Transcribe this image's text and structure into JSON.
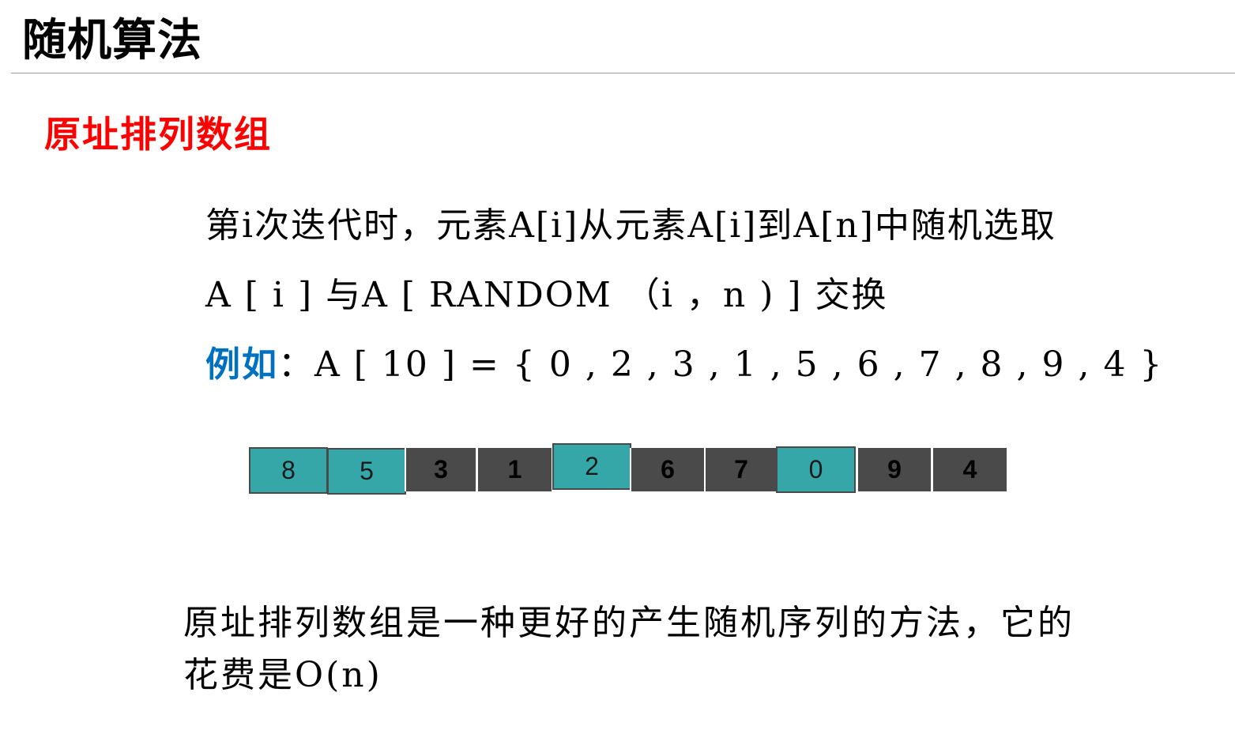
{
  "header": {
    "title": "随机算法"
  },
  "section": {
    "title": "原址排列数组"
  },
  "description": {
    "line1": "第i次迭代时，元素A[i]从元素A[i]到A[n]中随机选取",
    "line2": "A [ i ] 与A [ RANDOM （i ，n ) ] 交换",
    "example_label": "例如",
    "example_text": "：A [ 10 ] = { 0 , 2 , 3 , 1 , 5 , 6 , 7 , 8 , 9 , 4 }"
  },
  "array": {
    "cells": [
      {
        "value": "8",
        "highlighted": true
      },
      {
        "value": "5",
        "highlighted": true
      },
      {
        "value": "3",
        "highlighted": false
      },
      {
        "value": "1",
        "highlighted": false
      },
      {
        "value": "2",
        "highlighted": true
      },
      {
        "value": "6",
        "highlighted": false
      },
      {
        "value": "7",
        "highlighted": false
      },
      {
        "value": "0",
        "highlighted": true
      },
      {
        "value": "9",
        "highlighted": false
      },
      {
        "value": "4",
        "highlighted": false
      }
    ]
  },
  "conclusion": {
    "text": "原址排列数组是一种更好的产生随机序列的方法，它的花费是O(n)"
  },
  "colors": {
    "section_title": "#ff0000",
    "example_label": "#0070c0",
    "highlight_cell": "#36a7a9",
    "normal_cell": "#4a4a4a"
  }
}
